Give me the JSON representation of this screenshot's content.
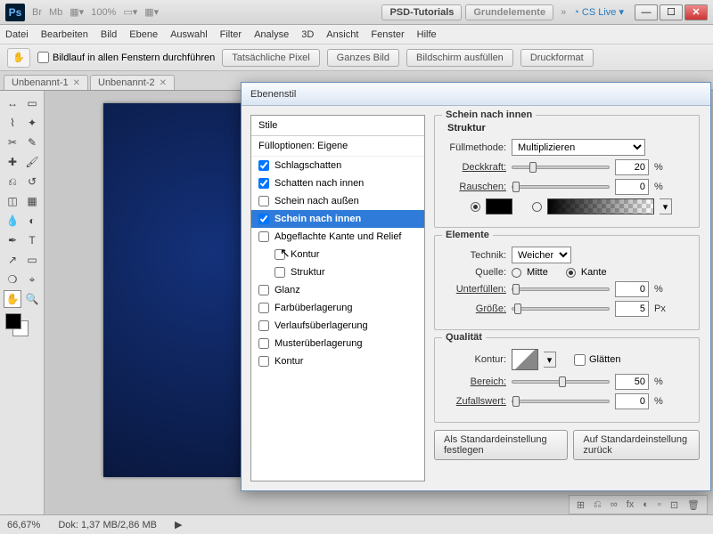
{
  "titlebar": {
    "app_badge": "Ps",
    "zoom": "100%",
    "btn_tutorials": "PSD-Tutorials",
    "btn_grund": "Grundelemente",
    "chevrons": "»",
    "cslive": "CS Live"
  },
  "menu": [
    "Datei",
    "Bearbeiten",
    "Bild",
    "Ebene",
    "Auswahl",
    "Filter",
    "Analyse",
    "3D",
    "Ansicht",
    "Fenster",
    "Hilfe"
  ],
  "options": {
    "scroll_label": "Bildlauf in allen Fenstern durchführen",
    "btns": [
      "Tatsächliche Pixel",
      "Ganzes Bild",
      "Bildschirm ausfüllen",
      "Druckformat"
    ]
  },
  "tabs": [
    {
      "label": "Unbenannt-1"
    },
    {
      "label": "Unbenannt-2"
    }
  ],
  "status": {
    "zoom": "66,67%",
    "doc": "Dok: 1,37 MB/2,86 MB"
  },
  "dialog": {
    "title": "Ebenenstil",
    "styles_header": "Stile",
    "fill_header": "Fülloptionen: Eigene",
    "effects": {
      "schlagschatten": "Schlagschatten",
      "schatten_innen": "Schatten nach innen",
      "schein_aussen": "Schein nach außen",
      "schein_innen": "Schein nach innen",
      "abgeflacht": "Abgeflachte Kante und Relief",
      "kontur_sub": "Kontur",
      "struktur_sub": "Struktur",
      "glanz": "Glanz",
      "farbueber": "Farbüberlagerung",
      "verlauf": "Verlaufsüberlagerung",
      "muster": "Musterüberlagerung",
      "kontur": "Kontur"
    },
    "panel_title": "Schein nach innen",
    "struktur": {
      "hdr": "Struktur",
      "fuellmethode": "Füllmethode:",
      "fuellmethode_val": "Multiplizieren",
      "deckkraft": "Deckkraft:",
      "deckkraft_val": "20",
      "rauschen": "Rauschen:",
      "rauschen_val": "0"
    },
    "elemente": {
      "hdr": "Elemente",
      "technik": "Technik:",
      "technik_val": "Weicher",
      "quelle": "Quelle:",
      "mitte": "Mitte",
      "kante": "Kante",
      "unterfuellen": "Unterfüllen:",
      "unterfuellen_val": "0",
      "groesse": "Größe:",
      "groesse_val": "5",
      "px": "Px"
    },
    "qualitaet": {
      "hdr": "Qualität",
      "kontur": "Kontur:",
      "glaetten": "Glätten",
      "bereich": "Bereich:",
      "bereich_val": "50",
      "zufall": "Zufallswert:",
      "zufall_val": "0"
    },
    "pct": "%",
    "btn_default": "Als Standardeinstellung festlegen",
    "btn_reset": "Auf Standardeinstellung zurück"
  }
}
